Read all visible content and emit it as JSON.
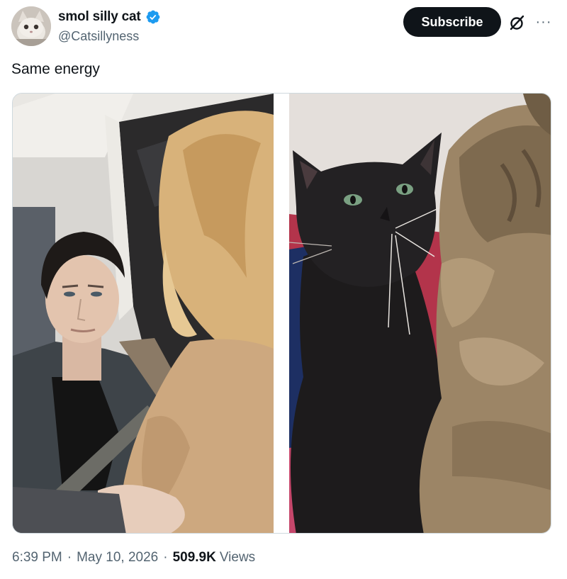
{
  "author": {
    "display_name": "smol silly cat",
    "handle": "@Catsillyness",
    "verified": true
  },
  "actions": {
    "subscribe_label": "Subscribe",
    "grok_icon": "slashed-circle-icon",
    "more_icon": "more-dots-icon",
    "more_label": "···"
  },
  "tweet": {
    "text": "Same energy",
    "time": "6:39 PM",
    "date": "May 10, 2026",
    "views_count": "509.9K",
    "views_label": "Views",
    "separator": "·"
  },
  "colors": {
    "verified_blue": "#1d9bf0",
    "text_primary": "#0f1419",
    "text_secondary": "#536471",
    "button_dark": "#0f1419"
  }
}
